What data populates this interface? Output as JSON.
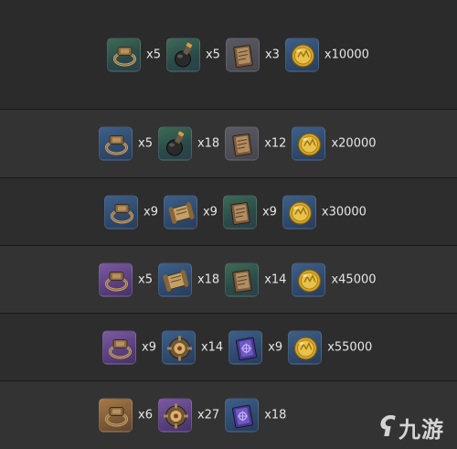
{
  "rows": [
    {
      "items": [
        {
          "icon": "ring-icon",
          "rarity": "green",
          "qty": "x5"
        },
        {
          "icon": "flask-icon",
          "rarity": "green",
          "qty": "x5"
        },
        {
          "icon": "book-icon",
          "rarity": "gray",
          "qty": "x3"
        },
        {
          "icon": "coin-icon",
          "rarity": "blue",
          "qty": "x10000"
        }
      ]
    },
    {
      "items": [
        {
          "icon": "ring-icon",
          "rarity": "blue",
          "qty": "x5"
        },
        {
          "icon": "flask-icon",
          "rarity": "green",
          "qty": "x18"
        },
        {
          "icon": "book-icon",
          "rarity": "gray",
          "qty": "x12"
        },
        {
          "icon": "coin-icon",
          "rarity": "blue",
          "qty": "x20000"
        }
      ]
    },
    {
      "items": [
        {
          "icon": "ring-icon",
          "rarity": "blue",
          "qty": "x9"
        },
        {
          "icon": "scroll-icon",
          "rarity": "blue",
          "qty": "x9"
        },
        {
          "icon": "book-icon",
          "rarity": "green",
          "qty": "x9"
        },
        {
          "icon": "coin-icon",
          "rarity": "blue",
          "qty": "x30000"
        }
      ]
    },
    {
      "items": [
        {
          "icon": "ring-icon",
          "rarity": "purple",
          "qty": "x5"
        },
        {
          "icon": "scroll-icon",
          "rarity": "blue",
          "qty": "x18"
        },
        {
          "icon": "book-icon",
          "rarity": "green",
          "qty": "x14"
        },
        {
          "icon": "coin-icon",
          "rarity": "blue",
          "qty": "x45000"
        }
      ]
    },
    {
      "items": [
        {
          "icon": "ring-icon",
          "rarity": "purple",
          "qty": "x9"
        },
        {
          "icon": "gear-icon",
          "rarity": "blue",
          "qty": "x14"
        },
        {
          "icon": "spellbook-icon",
          "rarity": "blue",
          "qty": "x9"
        },
        {
          "icon": "coin-icon",
          "rarity": "blue",
          "qty": "x55000"
        }
      ]
    },
    {
      "items": [
        {
          "icon": "ring-icon",
          "rarity": "gold",
          "qty": "x6"
        },
        {
          "icon": "gear-icon",
          "rarity": "purple",
          "qty": "x27"
        },
        {
          "icon": "spellbook-icon",
          "rarity": "blue",
          "qty": "x18"
        }
      ]
    }
  ],
  "watermark": {
    "text": "九游"
  }
}
